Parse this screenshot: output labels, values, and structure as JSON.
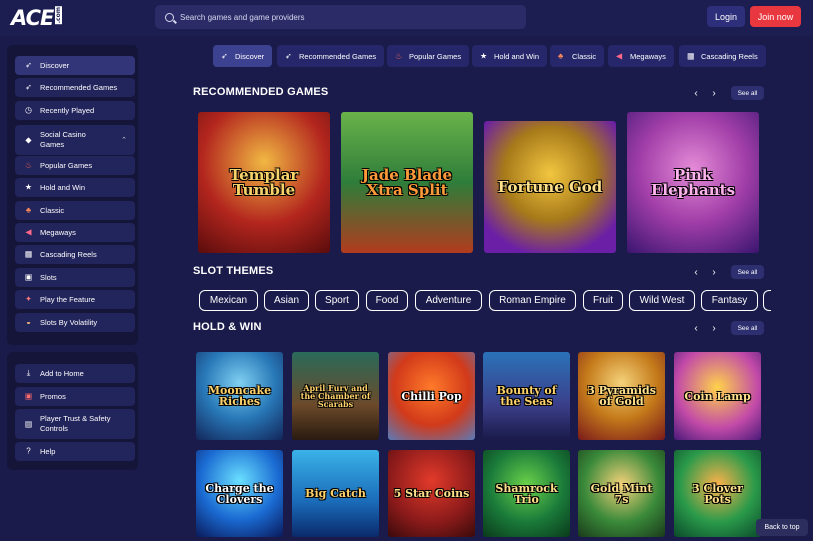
{
  "header": {
    "logo": "ACE",
    "logo_suffix": ".com",
    "search_placeholder": "Search games and game providers",
    "login": "Login",
    "join": "Join now"
  },
  "sidebar": {
    "main": [
      {
        "label": "Discover",
        "icon": "rocket-icon"
      },
      {
        "label": "Recommended Games",
        "icon": "rocket-icon"
      },
      {
        "label": "Recently Played",
        "icon": "clock-icon"
      },
      {
        "label": "Social Casino Games",
        "icon": "casino-icon"
      },
      {
        "label": "Popular Games",
        "icon": "fire-icon"
      },
      {
        "label": "Hold and Win",
        "icon": "star-icon"
      },
      {
        "label": "Classic",
        "icon": "classic-icon"
      },
      {
        "label": "Megaways",
        "icon": "megaways-icon"
      },
      {
        "label": "Cascading Reels",
        "icon": "reels-icon"
      },
      {
        "label": "Slots",
        "icon": "slots-icon"
      },
      {
        "label": "Play the Feature",
        "icon": "feature-icon"
      },
      {
        "label": "Slots By Volatility",
        "icon": "volatility-icon"
      }
    ],
    "secondary": [
      {
        "label": "Add to Home",
        "icon": "download-icon"
      },
      {
        "label": "Promos",
        "icon": "gift-icon"
      },
      {
        "label": "Player Trust & Safety Controls",
        "icon": "document-icon"
      },
      {
        "label": "Help",
        "icon": "help-icon"
      }
    ]
  },
  "categories": [
    {
      "label": "Discover",
      "icon": "rocket-icon"
    },
    {
      "label": "Recommended Games",
      "icon": "rocket-icon"
    },
    {
      "label": "Popular Games",
      "icon": "fire-icon"
    },
    {
      "label": "Hold and Win",
      "icon": "star-icon"
    },
    {
      "label": "Classic",
      "icon": "classic-icon"
    },
    {
      "label": "Megaways",
      "icon": "megaways-icon"
    },
    {
      "label": "Cascading Reels",
      "icon": "reels-icon"
    }
  ],
  "sections": {
    "recommended": {
      "title": "RECOMMENDED GAMES",
      "see_all": "See all",
      "games": [
        "Templar Tumble",
        "Jade Blade Xtra Split",
        "Fortune God",
        "Pink Elephants"
      ]
    },
    "themes": {
      "title": "SLOT THEMES",
      "see_all": "See all",
      "items": [
        "Mexican",
        "Asian",
        "Sport",
        "Food",
        "Adventure",
        "Roman Empire",
        "Fruit",
        "Wild West",
        "Fantasy"
      ]
    },
    "hold_win": {
      "title": "HOLD & WIN",
      "see_all": "See all",
      "games": [
        "Mooncake Riches",
        "April Fury and the Chamber of Scarabs",
        "Chilli Pop",
        "Bounty of the Seas",
        "3 Pyramids of Gold",
        "Coin Lamp",
        "Charge the Clovers",
        "Big Catch",
        "5 Star Coins",
        "Shamrock Trio",
        "Gold Mint 7s",
        "3 Clover Pots"
      ]
    }
  },
  "back_to_top": "Back to top",
  "colors": {
    "background": "#1a1b4b",
    "join": "#e8373e",
    "login": "#2d2f7a"
  }
}
